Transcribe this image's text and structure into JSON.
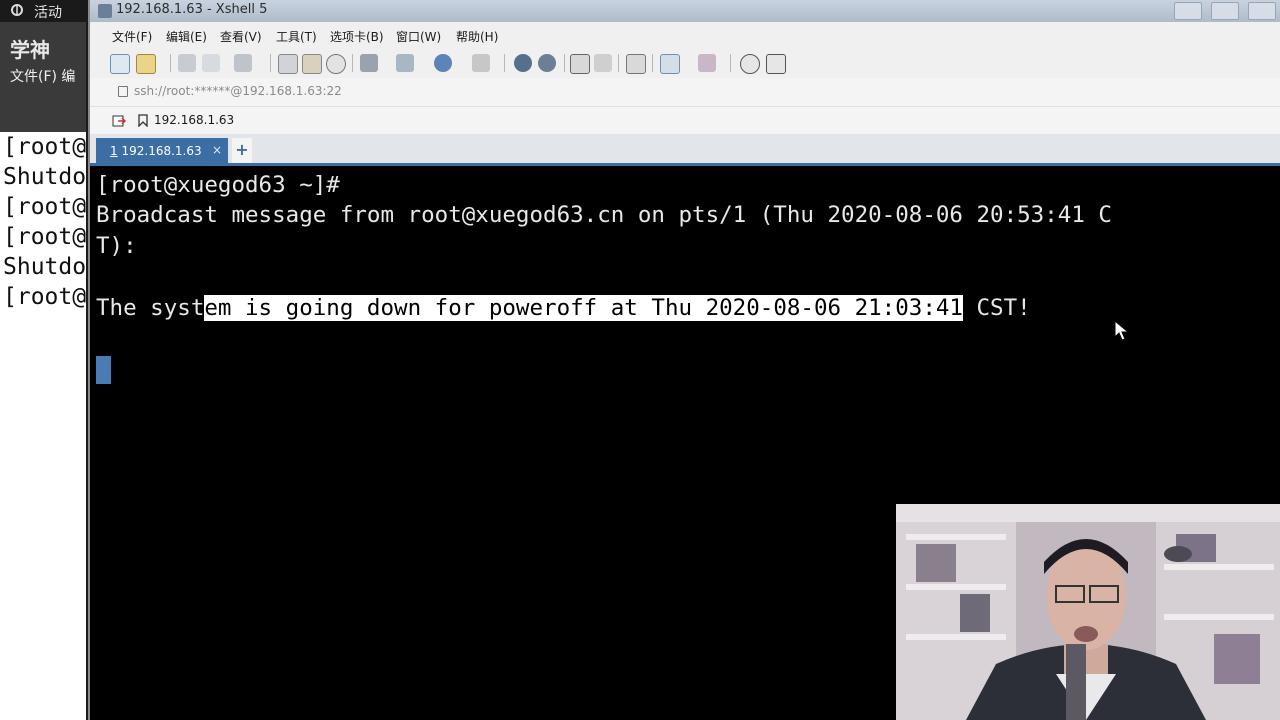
{
  "desktop": {
    "activities_label": "活动",
    "left_window": {
      "brand_text": "学神",
      "menu_text": "文件(F)  编",
      "terminal_lines": [
        "[root@",
        "Shutdo",
        "[root@",
        "[root@",
        "Shutdo",
        "[root@"
      ]
    }
  },
  "xshell": {
    "window_title": "192.168.1.63 - Xshell 5",
    "menu": [
      "文件(F)",
      "编辑(E)",
      "查看(V)",
      "工具(T)",
      "选项卡(B)",
      "窗口(W)",
      "帮助(H)"
    ],
    "address": "ssh://root:******@192.168.1.63:22",
    "session_bookmark": "192.168.1.63",
    "tabs": [
      {
        "number": "1",
        "label": "192.168.1.63",
        "active": true
      }
    ],
    "tab_close": "×",
    "tab_add": "+",
    "terminal": {
      "line1": "[root@xuegod63 ~]#",
      "line2": "Broadcast message from root@xuegod63.cn on pts/1 (Thu 2020-08-06 20:53:41 C",
      "line3": "T):",
      "line5_pre": "The syst",
      "line5_sel": "em is going down for poweroff at Thu 2020-08-06 21:03:41",
      "line5_post": " CST!"
    }
  },
  "colors": {
    "tab_active": "#3b6ea5",
    "terminal_bg": "#000000",
    "terminal_fg": "#e8e8e8",
    "selection_bg": "#ffffff",
    "cursor": "#4a7bb5"
  }
}
